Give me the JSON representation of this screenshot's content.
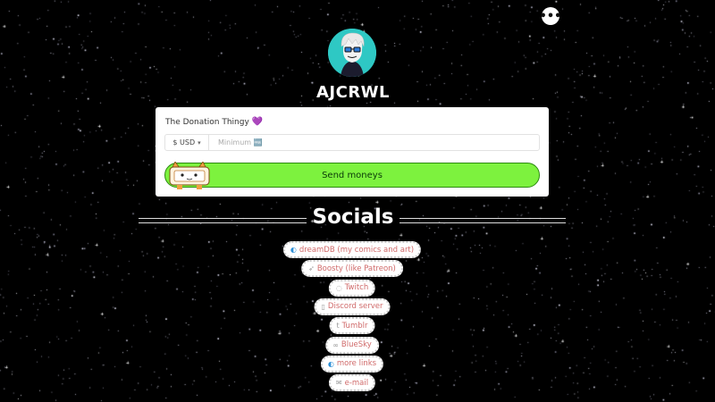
{
  "profile": {
    "menu_glyph": "•••",
    "username": "AJCRWL"
  },
  "donation": {
    "title": "The Donation Thingy",
    "heart_glyph": "💜",
    "currency": "$ USD",
    "amount_placeholder": "Minimum 🆓",
    "send_label": "Send moneys"
  },
  "socials": {
    "heading": "Socials",
    "links": [
      {
        "icon": "globe-icon",
        "glyph": "◐",
        "label": "dreamDB (my comics and art)"
      },
      {
        "icon": "boosty-icon",
        "glyph": "➶",
        "label": "Boosty (like Patreon)"
      },
      {
        "icon": "twitch-icon",
        "glyph": "◌",
        "label": "Twitch"
      },
      {
        "icon": "discord-icon",
        "glyph": "▯",
        "label": "Discord server"
      },
      {
        "icon": "tumblr-icon",
        "glyph": "t",
        "label": "Tumblr"
      },
      {
        "icon": "bluesky-icon",
        "glyph": "∞",
        "label": "BlueSky"
      },
      {
        "icon": "globe-icon",
        "glyph": "◐",
        "label": "more links"
      },
      {
        "icon": "mail-icon",
        "glyph": "✉",
        "label": "e-mail"
      }
    ]
  },
  "colors": {
    "background": "#000000",
    "send_button": "#7df23e",
    "link_text": "#d06a6a",
    "avatar_bg": "#2ec8c4"
  }
}
